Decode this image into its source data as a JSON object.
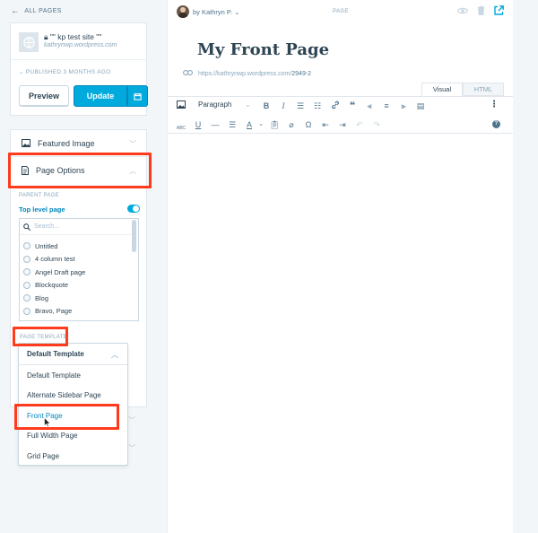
{
  "sidebar": {
    "back_label": "ALL PAGES",
    "site": {
      "name": "\"\" kp test site \"\"",
      "url": "kathrynwp.wordpress.com",
      "published": "PUBLISHED 3 MONTHS AGO"
    },
    "buttons": {
      "preview": "Preview",
      "update": "Update"
    },
    "sections": {
      "featured_image": "Featured Image",
      "page_options": "Page Options"
    },
    "parent_page": {
      "label": "PARENT PAGE",
      "top_level": "Top level page",
      "top_level_enabled": true,
      "search_placeholder": "Search...",
      "pages": [
        "Untitled",
        "4 column test",
        "Angel Draft page",
        "Blockquote",
        "Blog",
        "Bravo, Page"
      ]
    },
    "page_template": {
      "label": "PAGE TEMPLATE",
      "selected": "Default Template",
      "options": [
        "Default Template",
        "Alternate Sidebar Page",
        "Front Page",
        "Full Width Page",
        "Grid Page"
      ],
      "highlighted_option": "Front Page"
    }
  },
  "editor": {
    "author": "by Kathryn P.",
    "post_type": "PAGE",
    "title": "My Front Page",
    "permalink_base": "https://kathrynwp.wordpress.com/",
    "permalink_slug": "2949-2",
    "tabs": {
      "visual": "Visual",
      "html": "HTML",
      "active": "Visual"
    },
    "toolbar": {
      "format": "Paragraph"
    }
  },
  "colors": {
    "accent": "#00aadc",
    "link": "#0087be",
    "highlight": "#ff3b1d",
    "background": "#f3f6f8"
  }
}
